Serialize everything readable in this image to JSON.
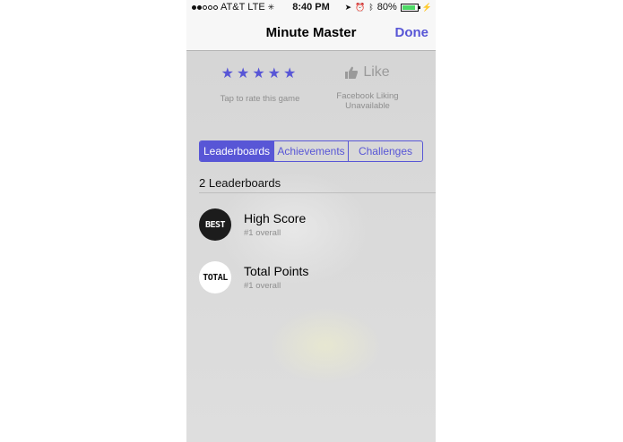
{
  "status_bar": {
    "carrier": "AT&T",
    "network": "LTE",
    "time": "8:40 PM",
    "battery": "80%",
    "battery_level": 0.8,
    "signal_bars": 2
  },
  "nav": {
    "title": "Minute Master",
    "done_label": "Done"
  },
  "rating": {
    "stars": "★★★★★",
    "caption": "Tap to rate this game"
  },
  "like": {
    "label": "Like",
    "caption_line1": "Facebook Liking",
    "caption_line2": "Unavailable"
  },
  "tabs": [
    "Leaderboards",
    "Achievements",
    "Challenges"
  ],
  "active_tab": "Leaderboards",
  "section_title": "2 Leaderboards",
  "leaderboards": [
    {
      "badge": "BEST",
      "name": "High Score",
      "rank": "#1 overall"
    },
    {
      "badge": "TOTAL",
      "name": "Total Points",
      "rank": "#1 overall"
    }
  ],
  "colors": {
    "accent": "#5856d6",
    "battery_fill": "#4cd964"
  }
}
